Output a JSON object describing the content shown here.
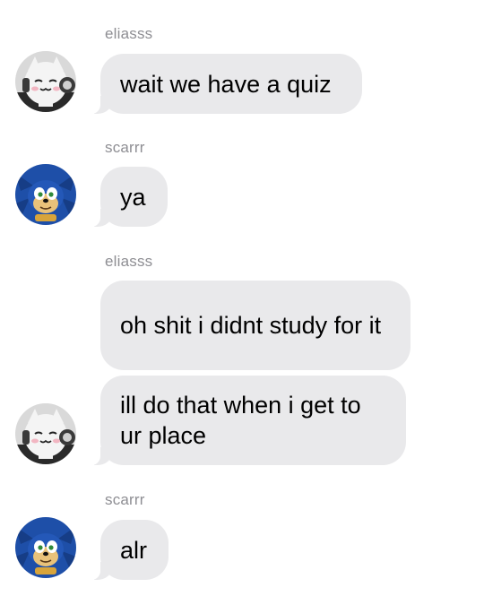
{
  "messages": [
    {
      "sender": "eliasss",
      "text": "wait we have a quiz"
    },
    {
      "sender": "scarrr",
      "text": "ya"
    },
    {
      "sender": "eliasss",
      "text": "oh shit i didnt study for it"
    },
    {
      "sender": "eliasss",
      "text": "ill do that when i get to ur place"
    },
    {
      "sender": "scarrr",
      "text": "alr"
    }
  ],
  "avatars": {
    "eliasss": "white-cat-character-avatar",
    "scarrr": "blue-hedgehog-character-avatar"
  },
  "colors": {
    "bubble": "#e9e9eb",
    "sender_name": "#8e8e93",
    "text": "#000000",
    "background": "#ffffff"
  }
}
